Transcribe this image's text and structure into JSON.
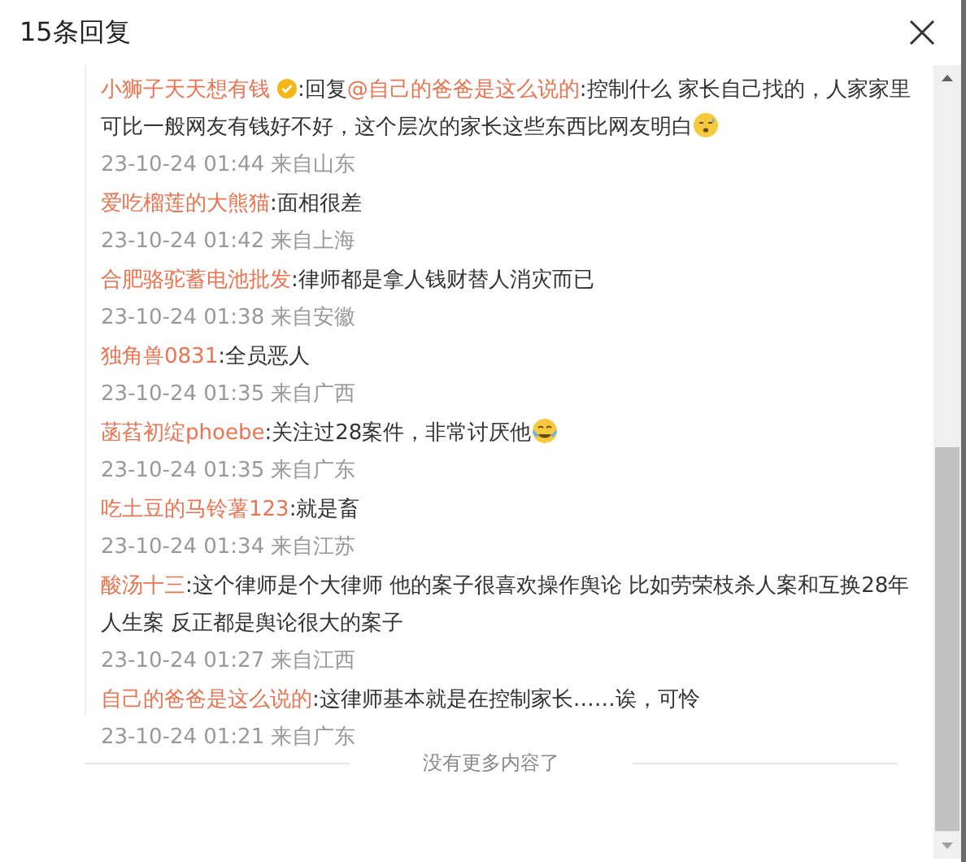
{
  "dialog": {
    "title": "15条回复"
  },
  "comments": [
    {
      "user": "小狮子天天想有钱",
      "verified": true,
      "segments": [
        {
          "kind": "plain",
          "text": ":回复"
        },
        {
          "kind": "mention",
          "text": "@自己的爸爸是这么说的"
        },
        {
          "kind": "plain",
          "text": ":控制什么 家长自己找的，人家家里可比一般网友有钱好不好，这个层次的家长这些东西比网友明白"
        },
        {
          "kind": "sweat"
        }
      ],
      "meta": "23-10-24 01:44 来自山东"
    },
    {
      "user": "爱吃榴莲的大熊猫",
      "verified": false,
      "segments": [
        {
          "kind": "plain",
          "text": ":面相很差"
        }
      ],
      "meta": "23-10-24 01:42 来自上海"
    },
    {
      "user": "合肥骆驼蓄电池批发",
      "verified": false,
      "segments": [
        {
          "kind": "plain",
          "text": ":律师都是拿人钱财替人消灾而已"
        }
      ],
      "meta": "23-10-24 01:38 来自安徽"
    },
    {
      "user": "独角兽0831",
      "verified": false,
      "segments": [
        {
          "kind": "plain",
          "text": ":全员恶人"
        }
      ],
      "meta": "23-10-24 01:35 来自广西"
    },
    {
      "user": "菡萏初绽phoebe",
      "verified": false,
      "segments": [
        {
          "kind": "plain",
          "text": ":关注过28案件，非常讨厌他"
        },
        {
          "kind": "laughcry"
        }
      ],
      "meta": "23-10-24 01:35 来自广东"
    },
    {
      "user": "吃土豆的马铃薯123",
      "verified": false,
      "segments": [
        {
          "kind": "plain",
          "text": ":就是畜"
        }
      ],
      "meta": "23-10-24 01:34 来自江苏"
    },
    {
      "user": "酸汤十三",
      "verified": false,
      "segments": [
        {
          "kind": "plain",
          "text": ":这个律师是个大律师 他的案子很喜欢操作舆论 比如劳荣枝杀人案和互换28年人生案 反正都是舆论很大的案子"
        }
      ],
      "meta": "23-10-24 01:27 来自江西"
    },
    {
      "user": "自己的爸爸是这么说的",
      "verified": false,
      "segments": [
        {
          "kind": "plain",
          "text": ":这律师基本就是在控制家长……诶，可怜"
        }
      ],
      "meta": "23-10-24 01:21 来自广东"
    }
  ],
  "end_note": "没有更多内容了"
}
